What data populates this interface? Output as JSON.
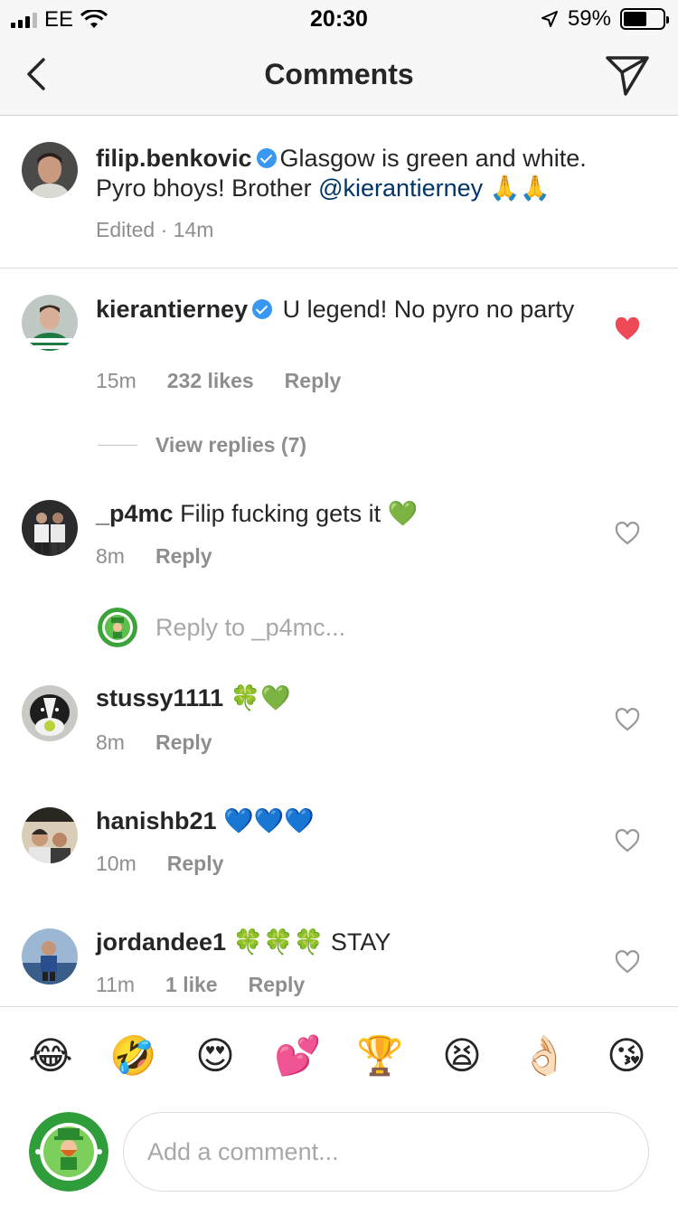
{
  "status_bar": {
    "carrier": "EE",
    "time": "20:30",
    "battery_text": "59%",
    "battery_level": 0.59
  },
  "header": {
    "title": "Comments",
    "back_icon": "chevron-left-icon",
    "share_icon": "paper-plane-icon"
  },
  "caption": {
    "username": "filip.benkovic",
    "text_before": "Glasgow is green and white. Pyro bhoys! Brother ",
    "mention": "@kierantierney",
    "text_after": " 🙏🙏",
    "time": "Edited · 14m"
  },
  "comments": [
    {
      "username": "kierantierney",
      "verified": true,
      "text": "U legend! No pyro no party",
      "time": "15m",
      "likes": "232 likes",
      "reply_label": "Reply",
      "liked": true
    },
    {
      "username": "_p4mc",
      "text": "Filip fucking gets it 💚",
      "time": "8m",
      "reply_label": "Reply",
      "liked": false
    },
    {
      "username": "stussy1111",
      "text": "🍀💚",
      "time": "8m",
      "reply_label": "Reply",
      "liked": false
    },
    {
      "username": "hanishb21",
      "text": "💙💙💙",
      "time": "10m",
      "reply_label": "Reply",
      "liked": false
    },
    {
      "username": "jordandee1",
      "text": "🍀🍀🍀 STAY",
      "time": "11m",
      "likes": "1 like",
      "reply_label": "Reply",
      "liked": false
    }
  ],
  "view_replies": "View replies (7)",
  "reply_to": "Reply to _p4mc...",
  "emojis": [
    "😂",
    "🤣",
    "😍",
    "💕",
    "🏆",
    "😫",
    "👌🏻",
    "😘"
  ],
  "composer": {
    "placeholder": "Add a comment..."
  },
  "colors": {
    "liked_heart": "#ed4956",
    "verified": "#3897f0",
    "mention": "#003569"
  }
}
